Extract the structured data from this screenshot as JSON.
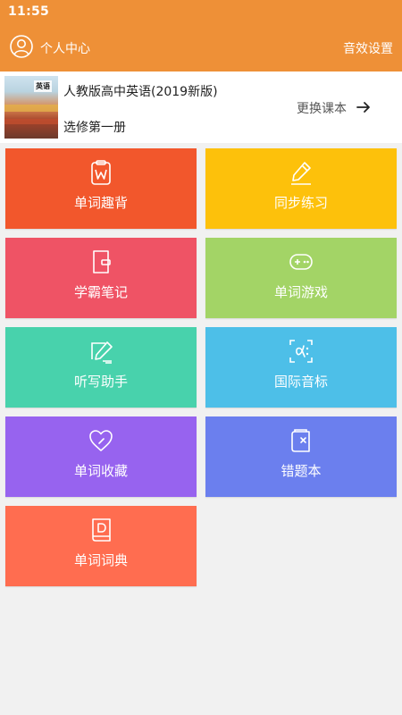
{
  "status_bar": {
    "time": "11:55"
  },
  "header": {
    "profile_label": "个人中心",
    "sound_settings_label": "音效设置",
    "background_color": "#ee9037"
  },
  "textbook": {
    "cover_text": "英语",
    "title": "人教版高中英语(2019新版)",
    "volume": "选修第一册",
    "change_label": "更换课本"
  },
  "tiles": [
    {
      "label": "单词趣背",
      "icon": "clipboard-w-icon",
      "color": "#f2572c"
    },
    {
      "label": "同步练习",
      "icon": "pencil-icon",
      "color": "#fdc10b"
    },
    {
      "label": "学霸笔记",
      "icon": "notebook-icon",
      "color": "#ef5365"
    },
    {
      "label": "单词游戏",
      "icon": "gamepad-icon",
      "color": "#a3d466"
    },
    {
      "label": "听写助手",
      "icon": "write-icon",
      "color": "#48d2ac"
    },
    {
      "label": "国际音标",
      "icon": "phonetic-alpha-icon",
      "color": "#4dbfe8"
    },
    {
      "label": "单词收藏",
      "icon": "heart-icon",
      "color": "#9763ef"
    },
    {
      "label": "错题本",
      "icon": "wrong-book-icon",
      "color": "#6b7fee"
    },
    {
      "label": "单词词典",
      "icon": "dictionary-icon",
      "color": "#ff6d50"
    }
  ]
}
